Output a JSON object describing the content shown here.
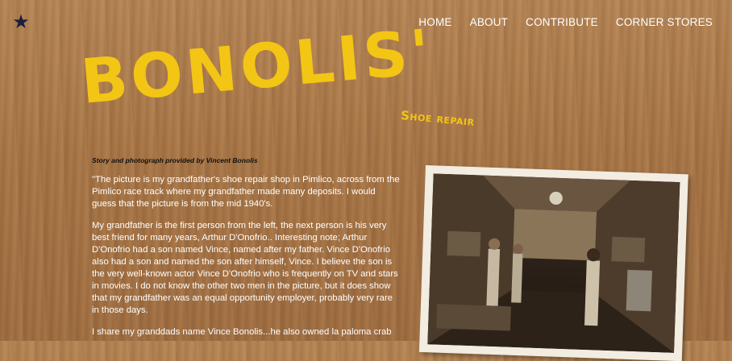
{
  "nav": {
    "items": [
      "HOME",
      "ABOUT",
      "CONTRIBUTE",
      "CORNER STORES"
    ]
  },
  "logo": {
    "title": "BONOLIS'",
    "subtitle": "Shoe repair"
  },
  "story": {
    "credit": "Story and photograph provided by Vincent Bonolis",
    "paragraphs": [
      "\"The picture is my grandfather's shoe repair shop in Pimlico, across from the Pimlico race track where my grandfather made many deposits. I would guess that the picture is from the mid 1940's.",
      "My grandfather is the first person from the left, the next person is his very best friend for many years, Arthur D'Onofrio.. Interesting note; Arthur D'Onofrio had a son named Vince, named after my father. Vince D'Onofrio also had a son and named the son after himself, Vince. I believe the  son is the very well-known actor Vince D'Onofrio who is frequently on  TV and stars in movies. I do not know the other two men in the picture, but it does show that my grandfather was an equal opportunity employer, probably very rare in those days.",
      "I share my granddads name Vince Bonolis...he also owned la paloma crab"
    ]
  },
  "icons": {
    "star": "star-icon"
  },
  "colors": {
    "logo_yellow": "#f3c515",
    "star_navy": "#1d1f3d"
  }
}
